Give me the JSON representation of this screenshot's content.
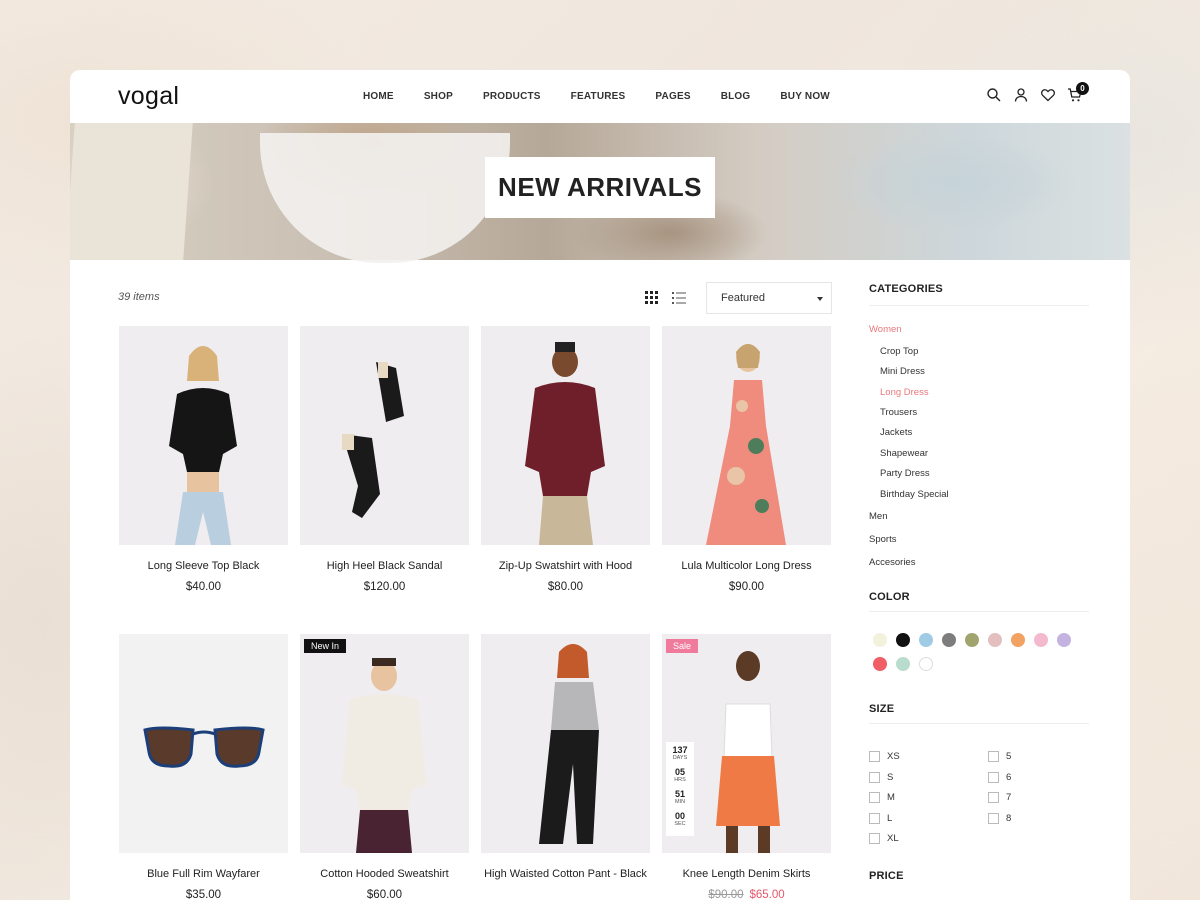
{
  "header": {
    "logo": "vogal",
    "nav": [
      "HOME",
      "SHOP",
      "PRODUCTS",
      "FEATURES",
      "PAGES",
      "BLOG",
      "BUY NOW"
    ],
    "icons": [
      "search-icon",
      "user-icon",
      "heart-icon",
      "cart-icon"
    ],
    "cart_count": "0"
  },
  "banner": {
    "title": "NEW ARRIVALS"
  },
  "toolbar": {
    "item_count": "39 items",
    "sort_selected": "Featured",
    "view_icons": [
      "grid-view-icon",
      "list-view-icon"
    ]
  },
  "products": [
    {
      "name": "Long Sleeve Top Black",
      "price": "$40.00"
    },
    {
      "name": "High Heel Black Sandal",
      "price": "$120.00"
    },
    {
      "name": "Zip-Up Swatshirt with Hood",
      "price": "$80.00"
    },
    {
      "name": "Lula Multicolor Long Dress",
      "price": "$90.00"
    },
    {
      "name": "Blue Full Rim Wayfarer",
      "price": "$35.00"
    },
    {
      "name": "Cotton Hooded Sweatshirt",
      "price": "$60.00",
      "badge": "New In"
    },
    {
      "name": "High Waisted Cotton Pant - Black",
      "price": "$..."
    },
    {
      "name": "Knee Length Denim Skirts",
      "old_price": "$90.00",
      "price": "$65.00",
      "badge": "Sale",
      "countdown": [
        {
          "num": "137",
          "label": "DAYS"
        },
        {
          "num": "05",
          "label": "HRS"
        },
        {
          "num": "51",
          "label": "MIN"
        },
        {
          "num": "00",
          "label": "SEC"
        }
      ]
    }
  ],
  "sidebar": {
    "categories_heading": "CATEGORIES",
    "categories": [
      {
        "label": "Women",
        "active": true
      },
      {
        "label": "Crop Top",
        "sub": true
      },
      {
        "label": "Mini Dress",
        "sub": true
      },
      {
        "label": "Long Dress",
        "sub": true,
        "active": true
      },
      {
        "label": "Trousers",
        "sub": true
      },
      {
        "label": "Jackets",
        "sub": true
      },
      {
        "label": "Shapewear",
        "sub": true
      },
      {
        "label": "Party Dress",
        "sub": true
      },
      {
        "label": "Birthday Special",
        "sub": true
      },
      {
        "label": "Men"
      },
      {
        "label": "Sports"
      },
      {
        "label": "Accesories"
      }
    ],
    "color_heading": "COLOR",
    "colors": [
      "#f1f1dc",
      "#111111",
      "#9fcbe6",
      "#7d7d7d",
      "#a2a470",
      "#e3bfc0",
      "#f2a263",
      "#f5b9ce",
      "#c4b3e1",
      "#ef5f65",
      "#b9dccf",
      "#ffffff"
    ],
    "size_heading": "SIZE",
    "sizes": [
      "XS",
      "S",
      "M",
      "L",
      "XL",
      "5",
      "6",
      "7",
      "8"
    ],
    "price_heading": "PRICE"
  }
}
